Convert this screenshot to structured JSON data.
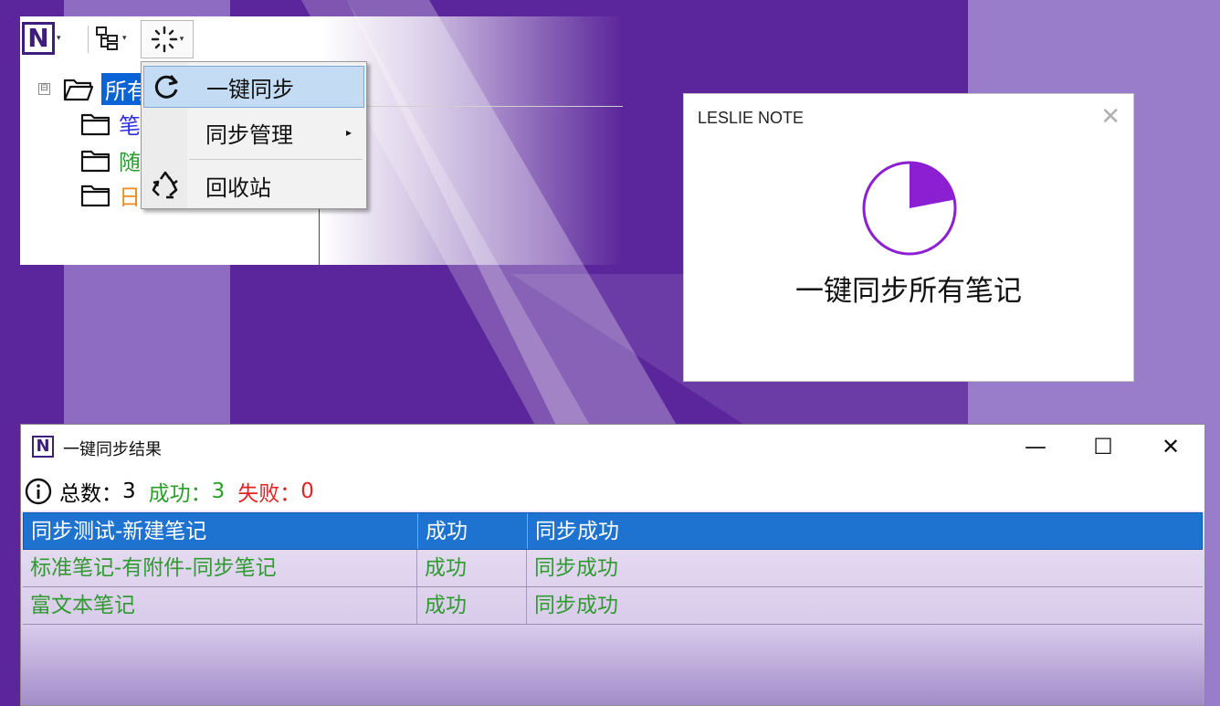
{
  "tree_window": {
    "toolbar": {
      "logo_text": "N",
      "dropdown_caret": "▾"
    },
    "root": {
      "collapse": "⊟",
      "label": "所有"
    },
    "items": [
      {
        "label": "笔",
        "color": "#2f2fe6"
      },
      {
        "label": "随",
        "color": "#2f9a2f"
      },
      {
        "label": "日",
        "color": "#ef8a1c"
      }
    ]
  },
  "menu": {
    "items": [
      {
        "label": "一键同步",
        "icon": "refresh-icon"
      },
      {
        "label": "同步管理",
        "icon": "",
        "has_submenu": true,
        "submenu_arrow": "▸"
      },
      {
        "label": "回收站",
        "icon": "recycle-icon"
      }
    ]
  },
  "dialog": {
    "title": "LESLIE NOTE",
    "close": "✕",
    "message": "一键同步所有笔记",
    "progress_fraction": 0.22,
    "accent": "#8c1fd1"
  },
  "result_window": {
    "logo_text": "N",
    "title": "一键同步结果",
    "controls": {
      "minimize": "—",
      "maximize": "☐",
      "close": "✕"
    },
    "summary": {
      "total_label": "总数：",
      "total": "3",
      "success_label": "成功：",
      "success": "3",
      "fail_label": "失败：",
      "fail": "0"
    },
    "rows": [
      {
        "name": "同步测试-新建笔记",
        "status": "成功",
        "message": "同步成功",
        "selected": true
      },
      {
        "name": "标准笔记-有附件-同步笔记",
        "status": "成功",
        "message": "同步成功",
        "selected": false
      },
      {
        "name": "富文本笔记",
        "status": "成功",
        "message": "同步成功",
        "selected": false
      }
    ]
  },
  "colors": {
    "desktop_bg": "#5b269b",
    "selection": "#1e73d0",
    "success": "#2aa02a",
    "fail": "#e32222"
  }
}
